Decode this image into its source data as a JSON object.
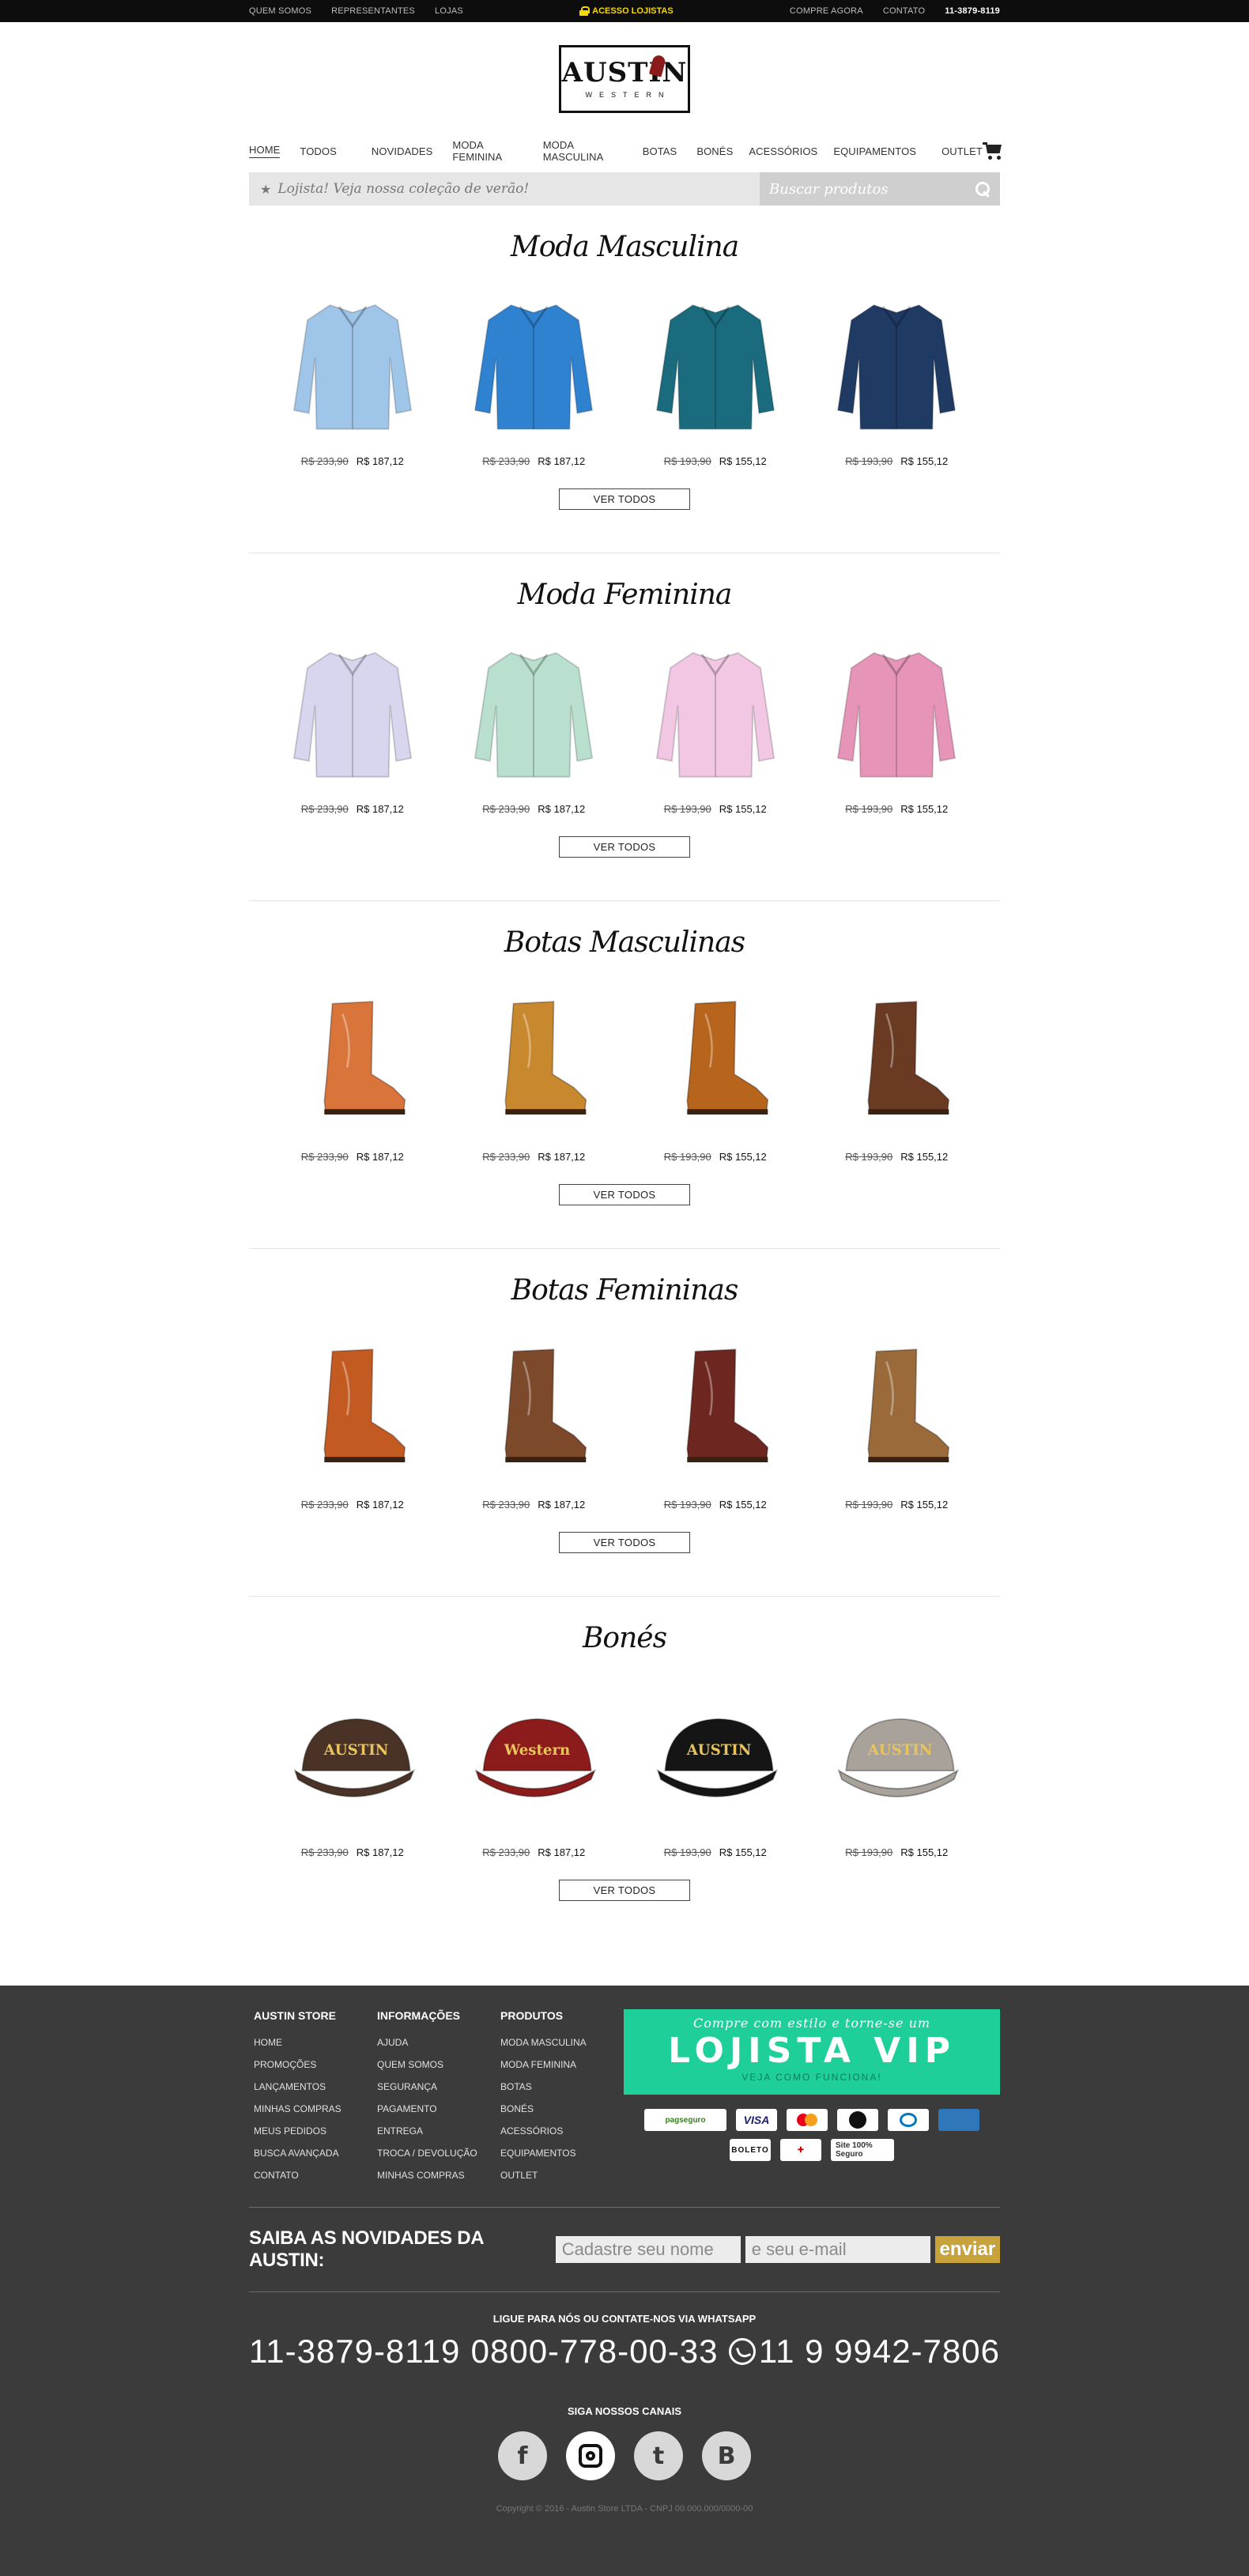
{
  "topbar": {
    "left": [
      "QUEM SOMOS",
      "REPRESENTANTES",
      "LOJAS"
    ],
    "center": "ACESSO LOJISTAS",
    "right_links": [
      "COMPRE AGORA",
      "CONTATO"
    ],
    "phone": "11-3879-8119"
  },
  "logo": {
    "brand": "AUSTIN",
    "sub": "WESTERN"
  },
  "nav": [
    "HOME",
    "TODOS",
    "NOVIDADES",
    "MODA FEMININA",
    "MODA MASCULINA",
    "BOTAS",
    "BONÉS",
    "ACESSÓRIOS",
    "EQUIPAMENTOS",
    "OUTLET"
  ],
  "search": {
    "message": "Lojista! Veja nossa coleção de verão!",
    "placeholder": "Buscar produtos"
  },
  "sections": [
    {
      "title": "Moda Masculina",
      "button": "VER TODOS",
      "products": [
        {
          "old": "R$ 233,90",
          "new": "R$ 187,12",
          "color": "#9fc5e8"
        },
        {
          "old": "R$ 233,90",
          "new": "R$ 187,12",
          "color": "#2f82d0"
        },
        {
          "old": "R$ 193,90",
          "new": "R$ 155,12",
          "color": "#1a6b7d"
        },
        {
          "old": "R$ 193,90",
          "new": "R$ 155,12",
          "color": "#1f3a63"
        }
      ]
    },
    {
      "title": "Moda Feminina",
      "button": "VER TODOS",
      "products": [
        {
          "old": "R$ 233,90",
          "new": "R$ 187,12",
          "color": "#d8d6ee"
        },
        {
          "old": "R$ 233,90",
          "new": "R$ 187,12",
          "color": "#b9dfcf"
        },
        {
          "old": "R$ 193,90",
          "new": "R$ 155,12",
          "color": "#f1c7e3"
        },
        {
          "old": "R$ 193,90",
          "new": "R$ 155,12",
          "color": "#e695b8"
        }
      ]
    },
    {
      "title": "Botas Masculinas",
      "button": "VER TODOS",
      "products": [
        {
          "old": "R$ 233,90",
          "new": "R$ 187,12",
          "color": "#d9743a"
        },
        {
          "old": "R$ 233,90",
          "new": "R$ 187,12",
          "color": "#c8892e"
        },
        {
          "old": "R$ 193,90",
          "new": "R$ 155,12",
          "color": "#b7641d"
        },
        {
          "old": "R$ 193,90",
          "new": "R$ 155,12",
          "color": "#6a3a22"
        }
      ]
    },
    {
      "title": "Botas Femininas",
      "button": "VER TODOS",
      "products": [
        {
          "old": "R$ 233,90",
          "new": "R$ 187,12",
          "color": "#c35a22"
        },
        {
          "old": "R$ 233,90",
          "new": "R$ 187,12",
          "color": "#7c4a2a"
        },
        {
          "old": "R$ 193,90",
          "new": "R$ 155,12",
          "color": "#6e2720"
        },
        {
          "old": "R$ 193,90",
          "new": "R$ 155,12",
          "color": "#9a6a3a"
        }
      ]
    },
    {
      "title": "Bonés",
      "button": "VER TODOS",
      "products": [
        {
          "old": "R$ 233,90",
          "new": "R$ 187,12",
          "color": "#4a3326",
          "label": "AUSTIN"
        },
        {
          "old": "R$ 233,90",
          "new": "R$ 187,12",
          "color": "#8c1c1c",
          "label": "Western"
        },
        {
          "old": "R$ 193,90",
          "new": "R$ 155,12",
          "color": "#151515",
          "label": "AUSTIN"
        },
        {
          "old": "R$ 193,90",
          "new": "R$ 155,12",
          "color": "#a8a29a",
          "label": "AUSTIN"
        }
      ]
    }
  ],
  "footer": {
    "cols": [
      {
        "title": "AUSTIN STORE",
        "links": [
          "HOME",
          "PROMOÇÕES",
          "LANÇAMENTOS",
          "MINHAS COMPRAS",
          "MEUS PEDIDOS",
          "BUSCA AVANÇADA",
          "CONTATO"
        ]
      },
      {
        "title": "INFORMAÇÕES",
        "links": [
          "AJUDA",
          "QUEM SOMOS",
          "SEGURANÇA",
          "PAGAMENTO",
          "ENTREGA",
          "TROCA / DEVOLUÇÃO",
          "MINHAS COMPRAS"
        ]
      },
      {
        "title": "PRODUTOS",
        "links": [
          "MODA MASCULINA",
          "MODA FEMININA",
          "BOTAS",
          "BONÉS",
          "ACESSÓRIOS",
          "EQUIPAMENTOS",
          "OUTLET"
        ]
      }
    ],
    "vip": {
      "line1": "Compre com estilo e torne-se um",
      "line2": "LOJISTA VIP",
      "line3": "VEJA COMO FUNCIONA!"
    },
    "payments": {
      "pagseguro": "pagseguro",
      "visa": "VISA",
      "boleto": "BOLETO",
      "seal2": "Site 100% Seguro"
    },
    "newsletter": {
      "label": "SAIBA AS NOVIDADES DA AUSTIN:",
      "name_placeholder": "Cadastre seu nome",
      "email_placeholder": "e seu e-mail",
      "button": "enviar"
    },
    "contact_caption": "LIGUE PARA NÓS OU CONTATE-NOS VIA WHATSAPP",
    "phones": [
      "11-3879-8119",
      "0800-778-00-33",
      "11 9 9942-7806"
    ],
    "social_caption": "SIGA NOSSOS CANAIS",
    "social": {
      "facebook": "f",
      "twitter": "t",
      "blogger": "B"
    },
    "copyright": "Copyright © 2016 - Austin Store LTDA - CNPJ 00.000.000/0000-00"
  }
}
